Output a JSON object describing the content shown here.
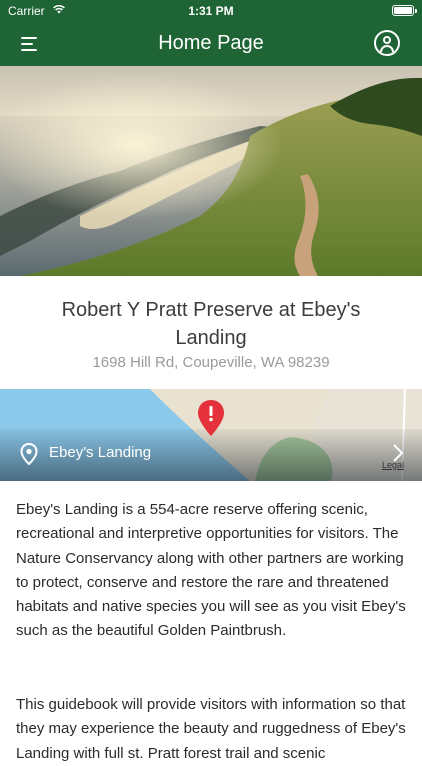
{
  "status_bar": {
    "carrier": "Carrier",
    "time": "1:31 PM"
  },
  "nav": {
    "title": "Home Page",
    "menu_icon": "hamburger-menu-icon",
    "account_icon": "user-circle-icon"
  },
  "hero": {
    "image": "coastal bluff trail at sunset"
  },
  "place": {
    "title": "Robert Y Pratt Preserve at Ebey's Landing",
    "address": "1698 Hill Rd, Coupeville, WA 98239"
  },
  "map": {
    "label": "Ebey's Landing",
    "legal": "Legal",
    "pin_color": "#e5313b"
  },
  "description": {
    "p1": "Ebey's Landing is a 554-acre reserve offering scenic, recreational and interpretive opportunities for visitors. The Nature Conservancy along with other partners are working to protect, conserve and restore the rare and threatened habitats and native species you will see as you visit Ebey's such as the beautiful Golden Paintbrush.",
    "p2": "This guidebook will provide visitors with information so that they may experience the beauty and ruggedness of Ebey's Landing with full st. Pratt forest trail and scenic"
  },
  "colors": {
    "brand": "#1f6435"
  }
}
